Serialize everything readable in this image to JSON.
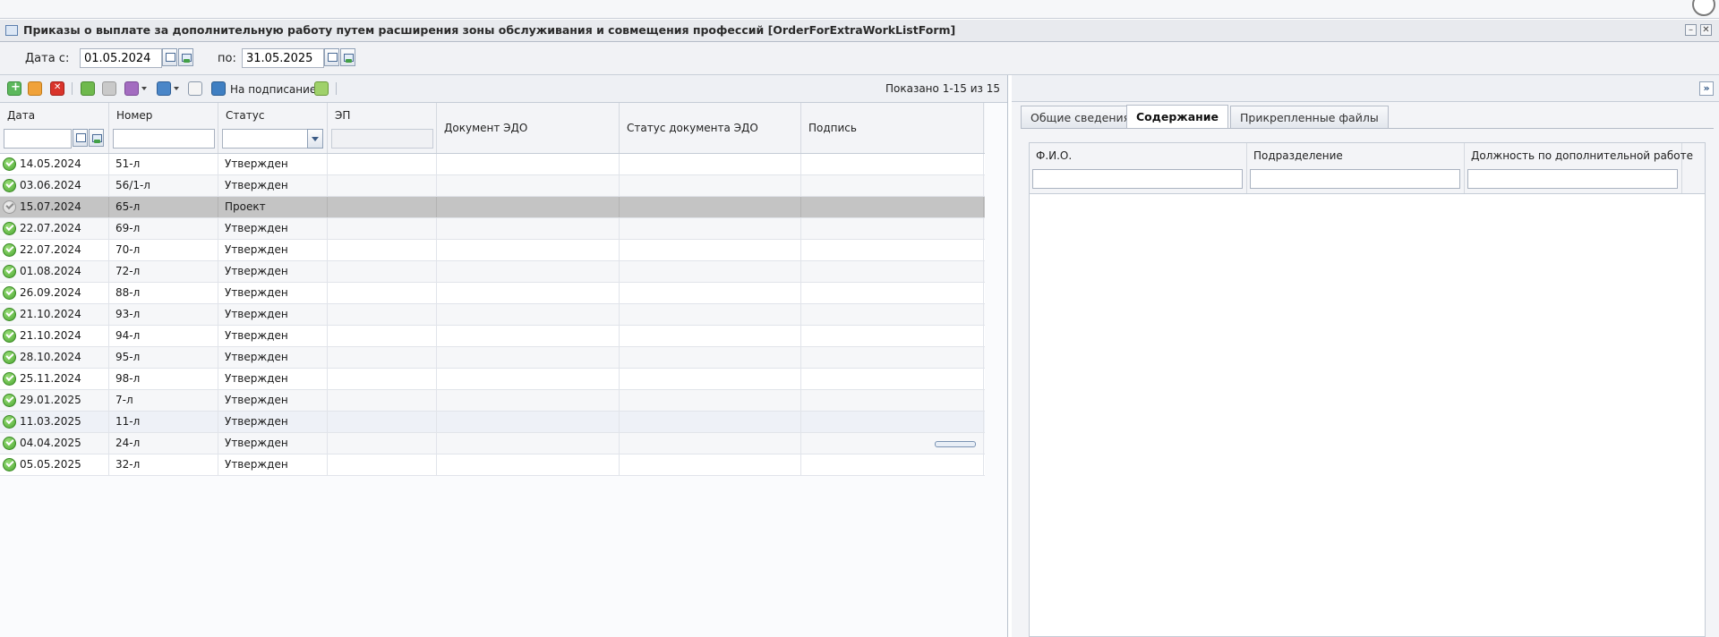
{
  "window": {
    "title": "Приказы о выплате за дополнительную работу путем расширения зоны обслуживания и совмещения профессий [OrderForExtraWorkListForm]"
  },
  "filter": {
    "date_from_label": "Дата с:",
    "date_from": "01.05.2024",
    "date_to_label": "по:",
    "date_to": "31.05.2025"
  },
  "toolbar": {
    "sign_label": "На подписание",
    "shown_text": "Показано 1-15 из 15"
  },
  "grid": {
    "columns": {
      "date": "Дата",
      "number": "Номер",
      "status": "Статус",
      "ep": "ЭП",
      "edo_doc": "Документ ЭДО",
      "edo_status": "Статус документа ЭДО",
      "signature": "Подпись"
    },
    "rows": [
      {
        "date": "14.05.2024",
        "number": "51-л",
        "status": "Утвержден",
        "state": "approved"
      },
      {
        "date": "03.06.2024",
        "number": "56/1-л",
        "status": "Утвержден",
        "state": "approved"
      },
      {
        "date": "15.07.2024",
        "number": "65-л",
        "status": "Проект",
        "state": "draft",
        "selected": true
      },
      {
        "date": "22.07.2024",
        "number": "69-л",
        "status": "Утвержден",
        "state": "approved"
      },
      {
        "date": "22.07.2024",
        "number": "70-л",
        "status": "Утвержден",
        "state": "approved"
      },
      {
        "date": "01.08.2024",
        "number": "72-л",
        "status": "Утвержден",
        "state": "approved"
      },
      {
        "date": "26.09.2024",
        "number": "88-л",
        "status": "Утвержден",
        "state": "approved"
      },
      {
        "date": "21.10.2024",
        "number": "93-л",
        "status": "Утвержден",
        "state": "approved"
      },
      {
        "date": "21.10.2024",
        "number": "94-л",
        "status": "Утвержден",
        "state": "approved"
      },
      {
        "date": "28.10.2024",
        "number": "95-л",
        "status": "Утвержден",
        "state": "approved"
      },
      {
        "date": "25.11.2024",
        "number": "98-л",
        "status": "Утвержден",
        "state": "approved"
      },
      {
        "date": "29.01.2025",
        "number": "7-л",
        "status": "Утвержден",
        "state": "approved"
      },
      {
        "date": "11.03.2025",
        "number": "11-л",
        "status": "Утвержден",
        "state": "approved",
        "hover": true
      },
      {
        "date": "04.04.2025",
        "number": "24-л",
        "status": "Утвержден",
        "state": "approved"
      },
      {
        "date": "05.05.2025",
        "number": "32-л",
        "status": "Утвержден",
        "state": "approved"
      }
    ]
  },
  "detail": {
    "tabs": [
      "Общие сведения",
      "Содержание",
      "Прикрепленные файлы"
    ],
    "active_tab": "Содержание",
    "columns": {
      "fio": "Ф.И.О.",
      "department": "Подразделение",
      "position": "Должность по дополнительной работе"
    }
  },
  "icons": {
    "approved": "check-circle-icon",
    "draft": "draft-circle-icon"
  }
}
